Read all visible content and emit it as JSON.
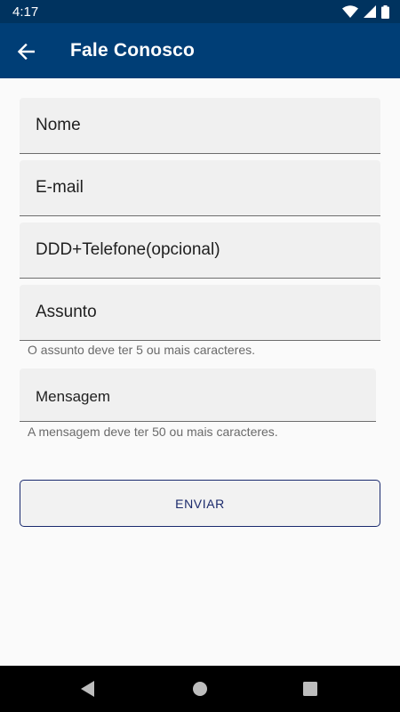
{
  "status_bar": {
    "time": "4:17",
    "icons": [
      "wifi-icon",
      "cell-signal-icon",
      "battery-icon"
    ]
  },
  "app_bar": {
    "title": "Fale Conosco",
    "back_icon": "arrow-back-icon",
    "color": "#003e76"
  },
  "form": {
    "fields": [
      {
        "label": "Nome",
        "value": ""
      },
      {
        "label": "E-mail",
        "value": ""
      },
      {
        "label": "DDD+Telefone(opcional)",
        "value": ""
      },
      {
        "label": "Assunto",
        "value": "",
        "helper": "O assunto deve ter 5 ou mais caracteres."
      },
      {
        "label": "Mensagem",
        "value": "",
        "helper": "A mensagem deve ter 50 ou mais caracteres."
      }
    ],
    "submit_label": "ENVIAR"
  },
  "nav_bar": {
    "buttons": [
      "back-triangle-icon",
      "home-circle-icon",
      "recents-square-icon"
    ]
  }
}
